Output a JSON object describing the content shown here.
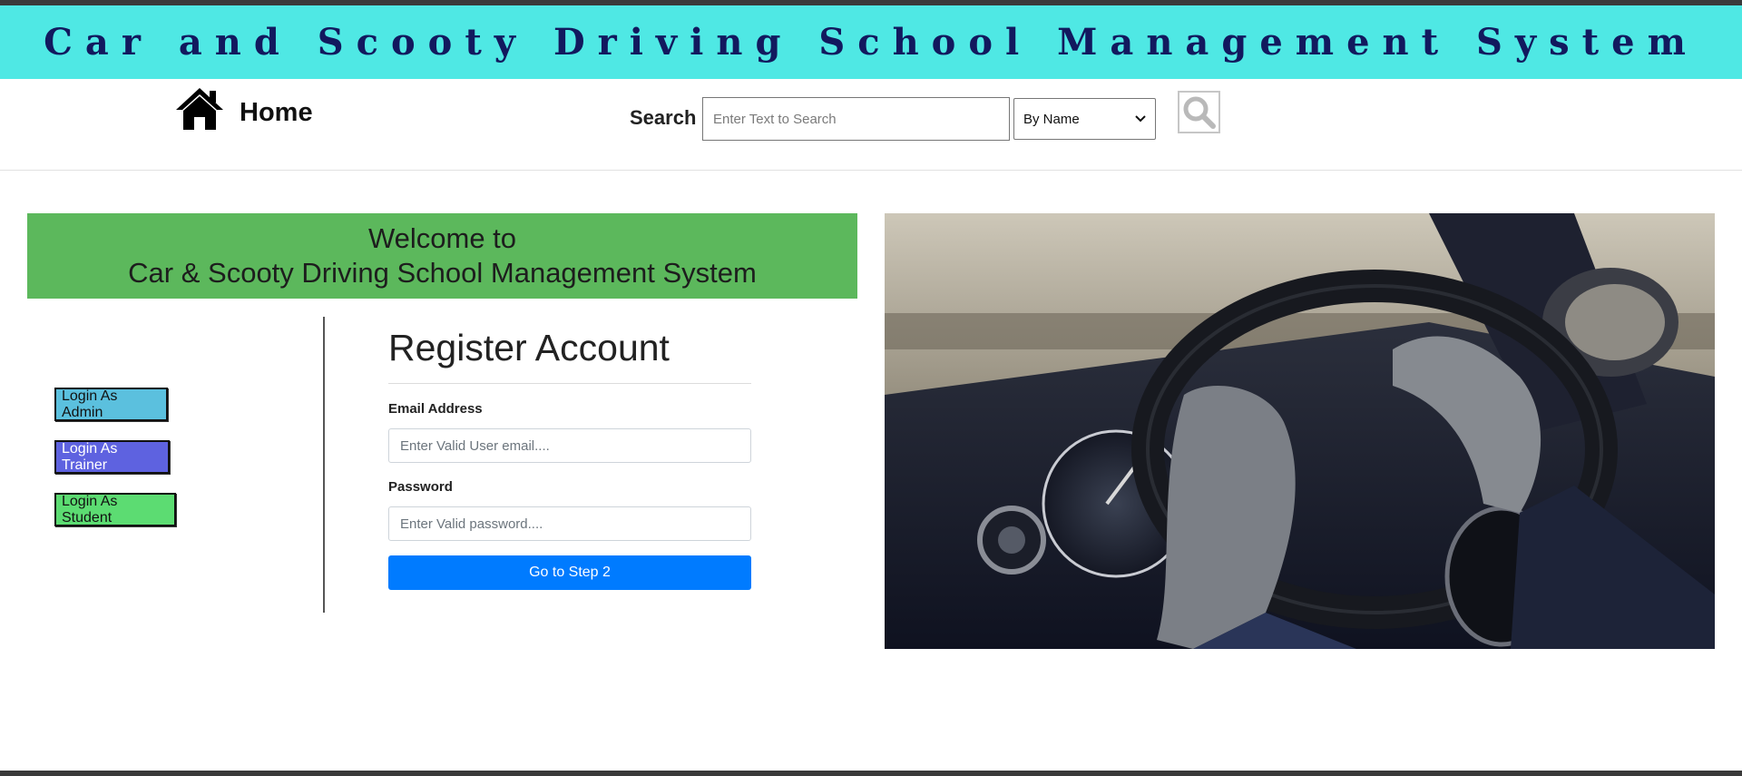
{
  "banner": {
    "title": "Car and Scooty Driving School Management System"
  },
  "nav": {
    "home_label": "Home",
    "search_label": "Search",
    "search_placeholder": "Enter Text to Search",
    "search_by_selected": "By Name"
  },
  "welcome": {
    "line1": "Welcome to",
    "line2": "Car & Scooty Driving School Management System"
  },
  "login_buttons": {
    "admin": "Login As Admin",
    "trainer": "Login As Trainer",
    "student": "Login As Student"
  },
  "register": {
    "title": "Register Account",
    "email_label": "Email Address",
    "email_placeholder": "Enter Valid User email....",
    "password_label": "Password",
    "password_placeholder": "Enter Valid password....",
    "submit_label": "Go to Step 2"
  },
  "colors": {
    "banner_bg": "#4fe8e4",
    "banner_text": "#12195e",
    "welcome_bg": "#5cb85c",
    "admin_btn": "#5bc0de",
    "trainer_btn": "#5e62e0",
    "student_btn": "#5cdc72",
    "primary_btn": "#007bff"
  },
  "icons": {
    "home": "home-icon",
    "search": "magnifier-icon",
    "dropdown": "chevron-down-icon"
  }
}
